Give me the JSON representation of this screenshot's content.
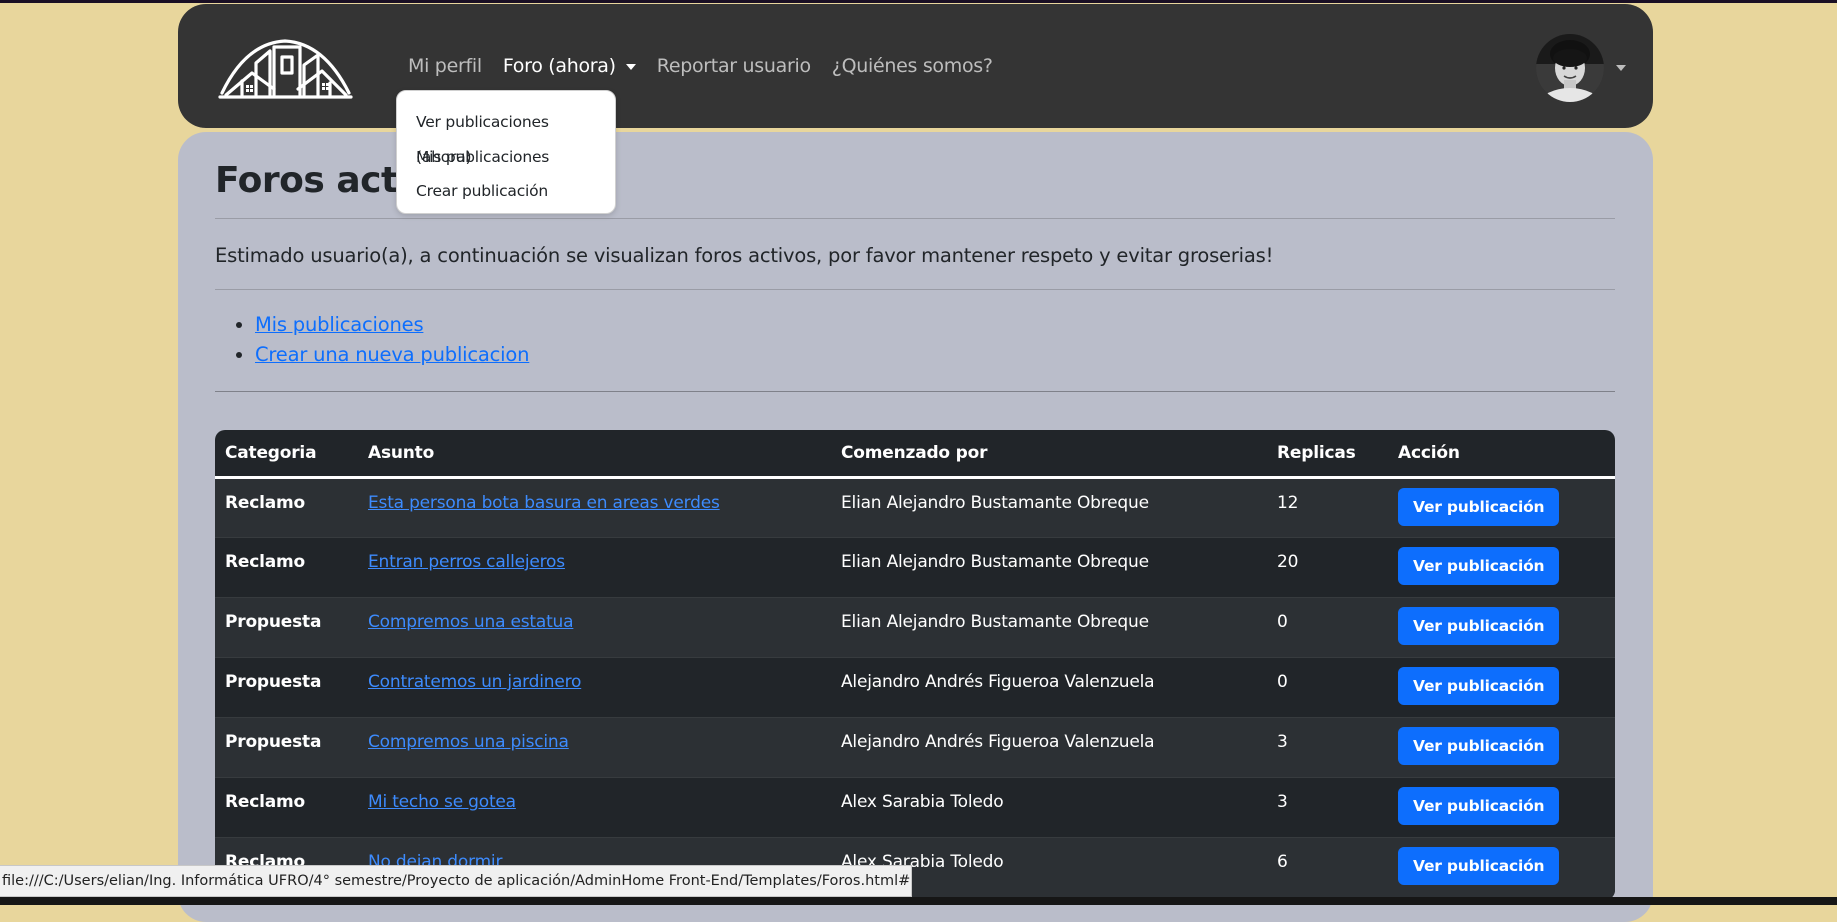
{
  "nav": {
    "items": [
      {
        "label": "Mi perfil"
      },
      {
        "label": "Foro (ahora)"
      },
      {
        "label": "Reportar usuario"
      },
      {
        "label": "¿Quiénes somos?"
      }
    ],
    "dropdown": [
      {
        "label": "Ver publicaciones (ahora)"
      },
      {
        "label": "Mis publicaciones"
      },
      {
        "label": "Crear publicación"
      }
    ]
  },
  "main": {
    "title": "Foros activos",
    "intro": "Estimado usuario(a), a continuación se visualizan foros activos, por favor mantener respeto y evitar groserias!",
    "links": [
      {
        "label": "Mis publicaciones"
      },
      {
        "label": "Crear una nueva publicacion"
      }
    ]
  },
  "table": {
    "headers": [
      "Categoria",
      "Asunto",
      "Comenzado por",
      "Replicas",
      "Acción"
    ],
    "button_label": "Ver publicación",
    "rows": [
      {
        "category": "Reclamo",
        "subject": "Esta persona bota basura en areas verdes",
        "author": "Elian Alejandro Bustamante Obreque",
        "replies": "12"
      },
      {
        "category": "Reclamo",
        "subject": "Entran perros callejeros",
        "author": "Elian Alejandro Bustamante Obreque",
        "replies": "20"
      },
      {
        "category": "Propuesta",
        "subject": "Compremos una estatua",
        "author": "Elian Alejandro Bustamante Obreque",
        "replies": "0"
      },
      {
        "category": "Propuesta",
        "subject": "Contratemos un jardinero",
        "author": "Alejandro Andrés Figueroa Valenzuela",
        "replies": "0"
      },
      {
        "category": "Propuesta",
        "subject": "Compremos una piscina",
        "author": "Alejandro Andrés Figueroa Valenzuela",
        "replies": "3"
      },
      {
        "category": "Reclamo",
        "subject": "Mi techo se gotea",
        "author": "Alex Sarabia Toledo",
        "replies": "3"
      },
      {
        "category": "Reclamo",
        "subject": "No dejan dormir",
        "author": "Alex Sarabia Toledo",
        "replies": "6"
      }
    ]
  },
  "statusbar": {
    "url": "file:///C:/Users/elian/Ing. Informática UFRO/4° semestre/Proyecto de aplicación/AdminHome Front-End/Templates/Foros.html#"
  },
  "colors": {
    "page_bg": "#e8d69c",
    "navbar_bg": "#343434",
    "card_bg": "#babdca",
    "table_bg": "#212529",
    "link": "#0d6efd",
    "button": "#0d6efd"
  },
  "icons": [
    "house-logo-icon",
    "dropdown-caret-icon",
    "avatar-photo"
  ]
}
